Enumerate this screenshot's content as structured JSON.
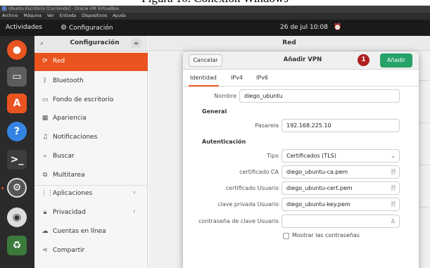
{
  "figure_caption": "Figura 10. Conexión Windows",
  "vbox": {
    "title": "Ubuntu Escritorio [Corriendo] - Oracle VM VirtualBox",
    "menu": [
      "Archivo",
      "Máquina",
      "Ver",
      "Entrada",
      "Dispositivos",
      "Ayuda"
    ]
  },
  "topbar": {
    "activities": "Actividades",
    "app": "Configuración",
    "clock": "26 de jul 10:08"
  },
  "sidebar": {
    "title": "Configuración",
    "items": [
      {
        "label": "Red",
        "icon": "network-icon",
        "selected": true
      },
      {
        "label": "Bluetooth",
        "icon": "bluetooth-icon"
      },
      {
        "label": "Fondo de escritorio",
        "icon": "wallpaper-icon"
      },
      {
        "label": "Apariencia",
        "icon": "appearance-icon"
      },
      {
        "label": "Notificaciones",
        "icon": "bell-icon"
      },
      {
        "label": "Buscar",
        "icon": "search-icon"
      },
      {
        "label": "Multitarea",
        "icon": "multitask-icon"
      },
      {
        "label": "Aplicaciones",
        "icon": "apps-icon",
        "chevron": true
      },
      {
        "label": "Privacidad",
        "icon": "lock-icon",
        "chevron": true
      },
      {
        "label": "Cuentas en línea",
        "icon": "cloud-icon"
      },
      {
        "label": "Compartir",
        "icon": "share-icon"
      }
    ]
  },
  "content": {
    "title": "Red"
  },
  "dialog": {
    "cancel": "Cancelar",
    "title": "Añadir VPN",
    "badge": "1",
    "add": "Añadir",
    "tabs": [
      "Identidad",
      "IPv4",
      "IPv6"
    ],
    "active_tab": "Identidad",
    "name_label": "Nombre",
    "name_value": "diego_ubuntu",
    "general_label": "General",
    "gateway_label": "Pasarela",
    "gateway_value": "192.168.225.10",
    "auth_label": "Autenticación",
    "type_label": "Tipo",
    "type_value": "Certificados (TLS)",
    "ca_label": "certificado CA",
    "ca_value": "diego_ubuntu-ca.pem",
    "usercert_label": "certificado Usuario",
    "usercert_value": "diego_ubuntu-cert.pem",
    "userkey_label": "clave privada Usuario",
    "userkey_value": "diego_ubuntu-key.pem",
    "keypass_label": "contraseña de clave Usuario",
    "keypass_value": "",
    "show_pass_label": "Mostrar las contraseñas"
  },
  "colors": {
    "accent": "#e95420",
    "add_button": "#26a269",
    "badge": "#b01f1f"
  }
}
